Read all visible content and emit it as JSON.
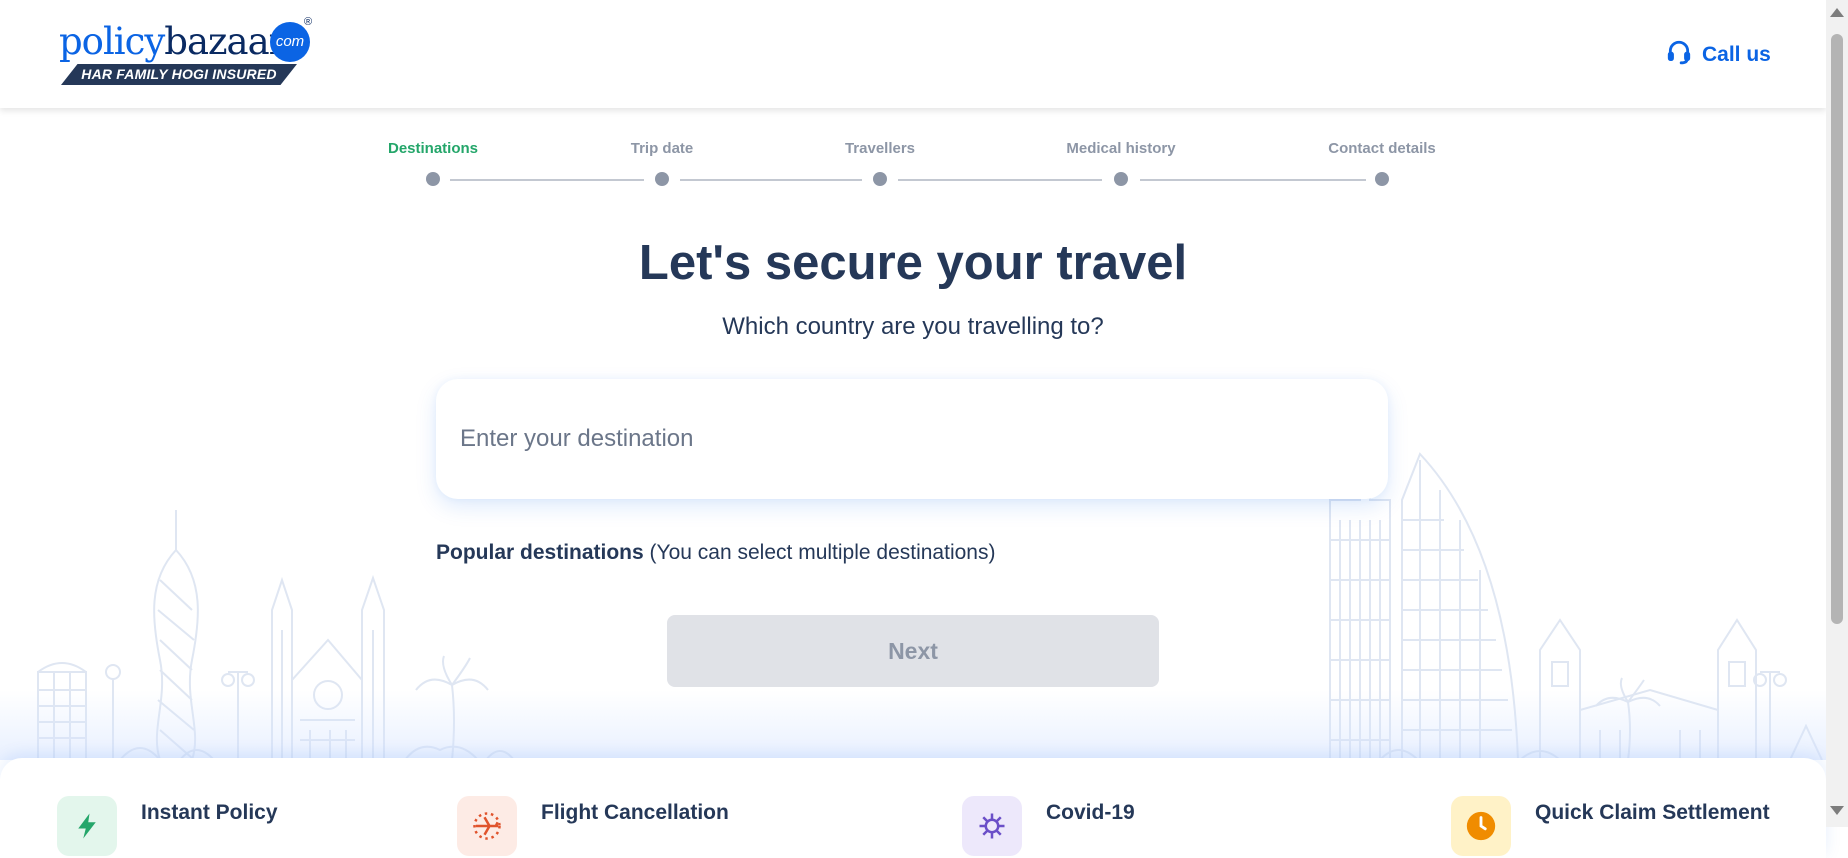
{
  "header": {
    "logo_part1": "policy",
    "logo_part2": "bazaar",
    "logo_dotcom": "com",
    "logo_reg": "®",
    "logo_tagline": "HAR FAMILY HOGI INSURED",
    "call_us_label": "Call us"
  },
  "stepper": {
    "steps": [
      {
        "label": "Destinations",
        "active": true
      },
      {
        "label": "Trip date",
        "active": false
      },
      {
        "label": "Travellers",
        "active": false
      },
      {
        "label": "Medical history",
        "active": false
      },
      {
        "label": "Contact details",
        "active": false
      }
    ]
  },
  "main": {
    "title": "Let's secure your travel",
    "subtitle": "Which country are you travelling to?",
    "destination_placeholder": "Enter your destination",
    "destination_value": "",
    "popular_strong": "Popular destinations",
    "popular_note": "(You can select multiple destinations)",
    "next_label": "Next"
  },
  "features": [
    {
      "title": "Instant Policy",
      "icon": "lightning-icon",
      "color": "#24a66a",
      "bg": "#e3f6ec"
    },
    {
      "title": "Flight Cancellation",
      "icon": "airplane-icon",
      "color": "#e0532c",
      "bg": "#fdebe5"
    },
    {
      "title": "Covid-19",
      "icon": "virus-icon",
      "color": "#6b4fc8",
      "bg": "#ede8fb"
    },
    {
      "title": "Quick Claim Settlement",
      "icon": "clock-icon",
      "color": "#f08c00",
      "bg": "#fff2c7"
    }
  ],
  "colors": {
    "brand_blue": "#0b64e4",
    "navy": "#253858",
    "active_green": "#24a66a",
    "inactive_grey": "#8d96a6"
  }
}
